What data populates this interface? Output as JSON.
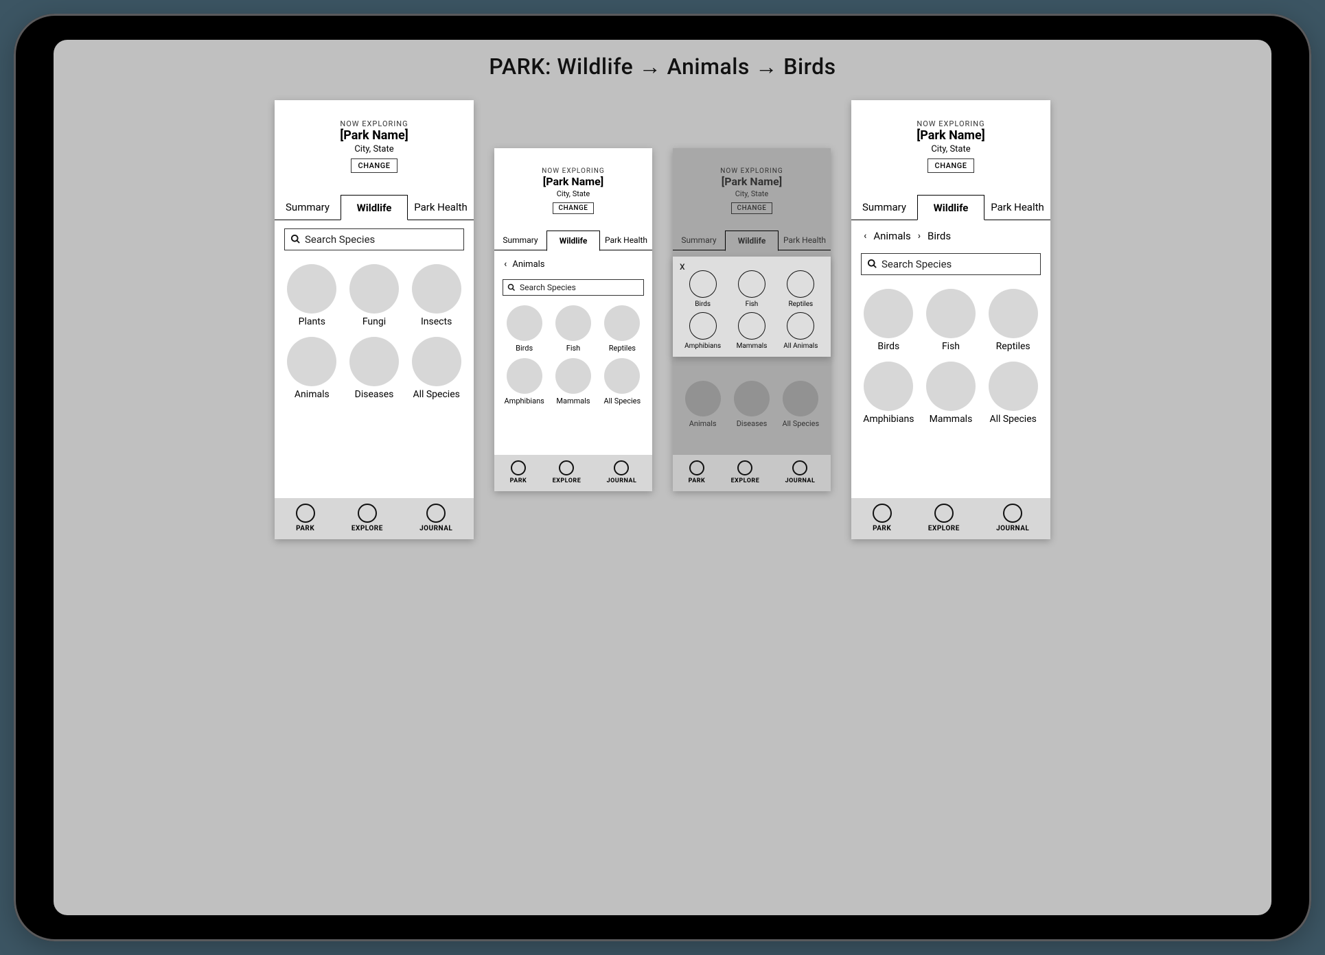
{
  "page_title": "PARK: Wildlife → Animals → Birds",
  "header": {
    "heading": "NOW EXPLORING",
    "parkname": "[Park Name]",
    "location": "City, State",
    "change": "CHANGE"
  },
  "tabs": {
    "summary": "Summary",
    "wildlife": "Wildlife",
    "park_health": "Park Health"
  },
  "search_placeholder": "Search Species",
  "bottom_nav": {
    "park": "PARK",
    "explore": "EXPLORE",
    "journal": "JOURNAL"
  },
  "screen1_categories": [
    "Plants",
    "Fungi",
    "Insects",
    "Animals",
    "Diseases",
    "All Species"
  ],
  "screen2_crumb": "Animals",
  "screen2_categories": [
    "Birds",
    "Fish",
    "Reptiles",
    "Amphibians",
    "Mammals",
    "All Species"
  ],
  "screen3_bg_categories": [
    "Animals",
    "Diseases",
    "All Species"
  ],
  "screen3_popup_items": [
    "Birds",
    "Fish",
    "Reptiles",
    "Amphibians",
    "Mammals",
    "All Animals"
  ],
  "screen3_popup_close": "X",
  "screen4_crumbs": {
    "a": "Animals",
    "b": "Birds"
  },
  "screen4_categories": [
    "Birds",
    "Fish",
    "Reptiles",
    "Amphibians",
    "Mammals",
    "All Species"
  ]
}
